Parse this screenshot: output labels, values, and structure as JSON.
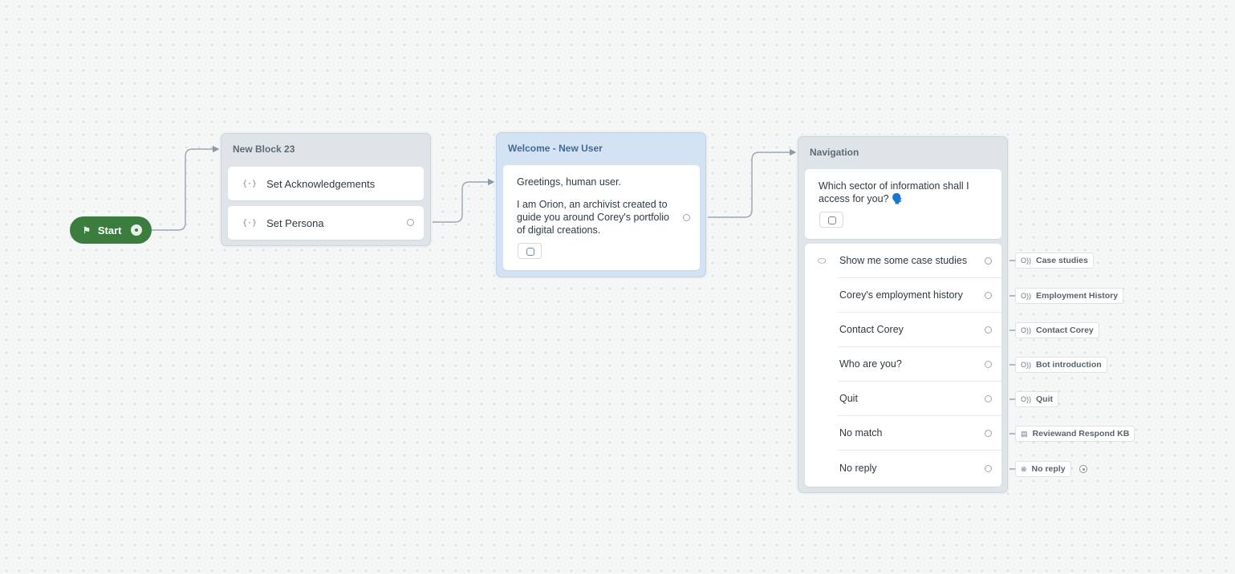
{
  "start": {
    "label": "Start",
    "flag_icon": "flag-icon"
  },
  "block_23": {
    "title": "New Block 23",
    "steps": [
      {
        "label": "Set Acknowledgements",
        "icon": "variable-icon"
      },
      {
        "label": "Set Persona",
        "icon": "variable-icon"
      }
    ]
  },
  "welcome": {
    "title": "Welcome - New User",
    "message_line1": "Greetings, human user.",
    "message_line2": "I am Orion, an archivist created to guide you around Corey's portfolio of digital creations."
  },
  "navigation": {
    "title": "Navigation",
    "question": "Which sector of information shall I access for you? 🗣️",
    "choices": [
      {
        "label": "Show me some case studies",
        "target": "Case studies",
        "target_icon": "intent-icon"
      },
      {
        "label": "Corey's employment history",
        "target": "Employment History",
        "target_icon": "intent-icon"
      },
      {
        "label": "Contact Corey",
        "target": "Contact Corey",
        "target_icon": "intent-icon"
      },
      {
        "label": "Who are you?",
        "target": "Bot introduction",
        "target_icon": "intent-icon"
      },
      {
        "label": "Quit",
        "target": "Quit",
        "target_icon": "intent-icon"
      },
      {
        "label": "No match",
        "target": "Reviewand Respond KB",
        "target_icon": "kb-icon"
      },
      {
        "label": "No reply",
        "target": "No reply",
        "target_icon": "no-reply-icon"
      }
    ]
  }
}
